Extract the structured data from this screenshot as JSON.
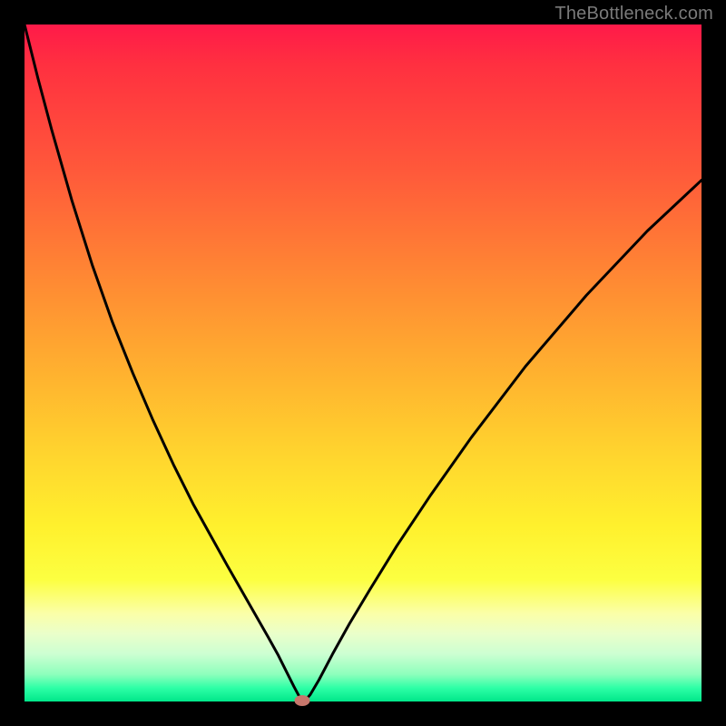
{
  "watermark": "TheBottleneck.com",
  "colors": {
    "marker": "#c7776c",
    "curve": "#000000"
  },
  "chart_data": {
    "type": "line",
    "title": "",
    "xlabel": "",
    "ylabel": "",
    "xlim": [
      0,
      100
    ],
    "ylim": [
      0,
      100
    ],
    "grid": false,
    "legend": false,
    "series": [
      {
        "name": "bottleneck-curve",
        "x": [
          0.0,
          2.0,
          4.0,
          7.0,
          10.0,
          13.0,
          16.0,
          19.0,
          22.0,
          25.0,
          27.5,
          30.0,
          32.0,
          34.0,
          36.0,
          37.5,
          38.8,
          39.8,
          40.5,
          41.0,
          41.5,
          42.2,
          43.5,
          45.5,
          48.0,
          51.0,
          55.0,
          60.0,
          66.0,
          74.0,
          83.0,
          92.0,
          100.0
        ],
        "y": [
          100.0,
          92.0,
          84.5,
          74.0,
          64.5,
          56.0,
          48.5,
          41.5,
          35.0,
          29.0,
          24.5,
          20.0,
          16.5,
          13.0,
          9.5,
          6.8,
          4.2,
          2.2,
          0.9,
          0.15,
          0.2,
          1.0,
          3.2,
          7.0,
          11.5,
          16.5,
          23.0,
          30.5,
          39.0,
          49.5,
          60.0,
          69.5,
          77.0
        ]
      }
    ],
    "marker": {
      "x": 41.0,
      "y": 0.15
    },
    "background": "rainbow-vertical-gradient"
  }
}
